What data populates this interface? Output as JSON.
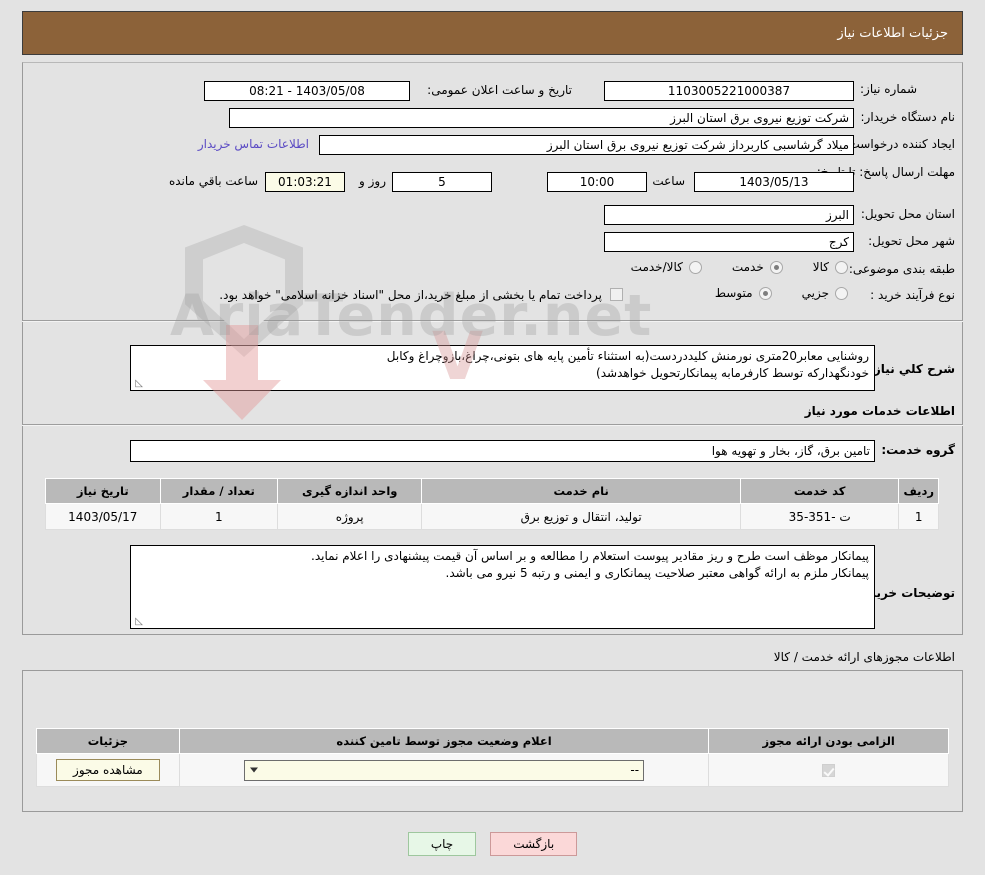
{
  "header": {
    "title": "جزئیات اطلاعات نیاز"
  },
  "form": {
    "need_number_label": "شماره نیاز:",
    "need_number_value": "1103005221000387",
    "announce_label": "تاریخ و ساعت اعلان عمومی:",
    "announce_value": "1403/05/08 - 08:21",
    "buyer_org_label": "نام دستگاه خریدار:",
    "buyer_org_value": "شرکت توزیع نیروی برق استان البرز",
    "creator_label": "ایجاد کننده درخواست:",
    "creator_value": "میلاد گرشاسبی کاربرداز شرکت توزیع نیروی برق استان البرز",
    "contact_link": "اطلاعات تماس خریدار",
    "deadline_label": "مهلت ارسال پاسخ: تا تاریخ:",
    "deadline_date": "1403/05/13",
    "hour_label": "ساعت",
    "hour_value": "10:00",
    "days_value": "5",
    "days_unit_label": "روز و",
    "remaining_time": "01:03:21",
    "remaining_label": "ساعت باقي مانده",
    "province_label": "استان محل تحویل:",
    "province_value": "البرز",
    "city_label": "شهر محل تحویل:",
    "city_value": "کرج",
    "category_label": "طبقه بندی موضوعی:",
    "category_options": [
      {
        "label": "کالا",
        "checked": false
      },
      {
        "label": "خدمت",
        "checked": true
      },
      {
        "label": "کالا/خدمت",
        "checked": false
      }
    ],
    "process_label": "نوع فرآیند خرید :",
    "process_options": [
      {
        "label": "جزیي",
        "checked": false
      },
      {
        "label": "متوسط",
        "checked": true
      }
    ],
    "treasury_checked": false,
    "treasury_text": "پرداخت تمام یا بخشی از مبلغ خرید،از محل \"اسناد خزانه اسلامی\" خواهد بود.",
    "need_desc_label": "شرح کلي نیاز:",
    "need_desc_line1": "روشنایی معابر20متری نورمنش کلیددردست(به استثناء تأمین پایه های بتونی،چراغ،بازوچراغ وکابل",
    "need_desc_line2": "خودنگهدارکه توسط کارفرمابه پیمانکارتحویل خواهدشد)",
    "services_section_label": "اطلاعات خدمات مورد نیاز",
    "service_group_label": "گروه خدمت:",
    "service_group_value": "تامین برق، گاز، بخار و تهویه هوا",
    "buyer_notes_label": "توضیحات خریدار:",
    "buyer_notes_line1": "پیمانکار موظف است طرح و ریز مقادیر پیوست استعلام را مطالعه و بر اساس آن قیمت پیشنهادی را اعلام نماید.",
    "buyer_notes_line2": "پیمانکار ملزم به ارائه گواهی معتبر صلاحیت پیمانکاری و ایمنی و رتبه 5 نیرو می باشد."
  },
  "services_table": {
    "headers": [
      "ردیف",
      "کد خدمت",
      "نام خدمت",
      "واحد اندازه گیری",
      "تعداد / مقدار",
      "تاریخ نیاز"
    ],
    "rows": [
      {
        "index": "1",
        "code": "ت -351-35",
        "name": "تولید، انتقال و توزیع برق",
        "unit": "پروژه",
        "quantity": "1",
        "need_date": "1403/05/17"
      }
    ]
  },
  "permits": {
    "section_label": "اطلاعات مجوزهای ارائه خدمت / کالا",
    "headers": [
      "الزامی بودن ارائه مجوز",
      "اعلام وضعیت مجوز توسط تامین کننده",
      "جزئیات"
    ],
    "rows": [
      {
        "required_checked": true,
        "status_value": "--",
        "detail_button": "مشاهده مجوز"
      }
    ]
  },
  "footer": {
    "print_label": "چاپ",
    "back_label": "بازگشت"
  },
  "watermark": {
    "brand": "AriaTender.net"
  },
  "colors": {
    "header_bg": "#8c6239",
    "link": "#5b4bc4",
    "table_header_bg": "#b9b9b9",
    "cream": "#fbfbe7",
    "print_btn": "#e7f7e7",
    "back_btn": "#fbd8d8"
  }
}
